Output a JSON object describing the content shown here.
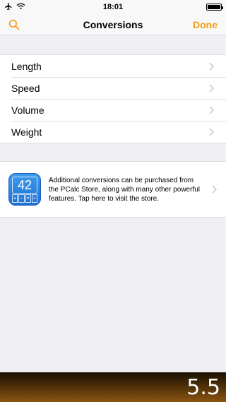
{
  "status": {
    "time": "18:01"
  },
  "nav": {
    "title": "Conversions",
    "done_label": "Done"
  },
  "conversions": {
    "items": [
      {
        "label": "Length"
      },
      {
        "label": "Speed"
      },
      {
        "label": "Volume"
      },
      {
        "label": "Weight"
      }
    ]
  },
  "store": {
    "description": "Additional conversions can be purchased from the PCalc Store, along with many other powerful features. Tap here to visit the store.",
    "icon_display": "42",
    "icon_keys": [
      "+",
      "−",
      "×",
      "÷"
    ]
  },
  "display": {
    "value": "5.5"
  },
  "colors": {
    "accent": "#f49b18",
    "background": "#efeff4"
  },
  "icons": {
    "search": "search-icon",
    "chevron": "chevron-right-icon",
    "airplane": "airplane-icon",
    "wifi": "wifi-icon",
    "battery": "battery-icon"
  }
}
